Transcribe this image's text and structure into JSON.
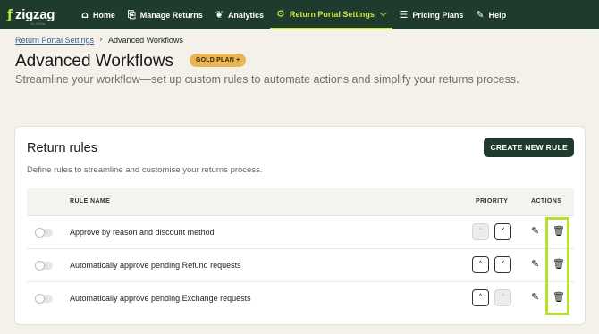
{
  "nav": {
    "logo": {
      "mark": "ƒ",
      "text": "zigzag",
      "sub": "GLOBAL"
    },
    "items": [
      {
        "label": "Home",
        "icon": "home-icon",
        "glyph": "⌂"
      },
      {
        "label": "Manage Returns",
        "icon": "returns-icon",
        "glyph": "⎘"
      },
      {
        "label": "Analytics",
        "icon": "megaphone-icon",
        "glyph": "📢"
      },
      {
        "label": "Return Portal Settings",
        "icon": "gear-icon",
        "glyph": "⚙",
        "active": true
      },
      {
        "label": "Pricing Plans",
        "icon": "list-icon",
        "glyph": "☰"
      },
      {
        "label": "Help",
        "icon": "help-icon",
        "glyph": "✎"
      }
    ]
  },
  "breadcrumb": {
    "parent": "Return Portal Settings",
    "current": "Advanced Workflows"
  },
  "page": {
    "title": "Advanced Workflows",
    "badge": "GOLD PLAN +",
    "subtitle": "Streamline your workflow—set up custom rules to automate actions and simplify your returns process."
  },
  "card": {
    "title": "Return rules",
    "create_button": "CREATE NEW RULE",
    "description": "Define rules to streamline and customise your returns process.",
    "columns": {
      "name": "RULE NAME",
      "priority": "PRIORITY",
      "actions": "ACTIONS"
    },
    "rules": [
      {
        "name": "Approve by reason and discount method",
        "enabled": false,
        "up_disabled": true,
        "down_disabled": false
      },
      {
        "name": "Automatically approve pending Refund requests",
        "enabled": false,
        "up_disabled": false,
        "down_disabled": false
      },
      {
        "name": "Automatically approve pending Exchange requests",
        "enabled": false,
        "up_disabled": false,
        "down_disabled": true
      }
    ]
  },
  "colors": {
    "nav_bg": "#1f3b2d",
    "accent": "#c8e64a",
    "badge": "#e8b454",
    "highlight": "#b6e02c"
  }
}
